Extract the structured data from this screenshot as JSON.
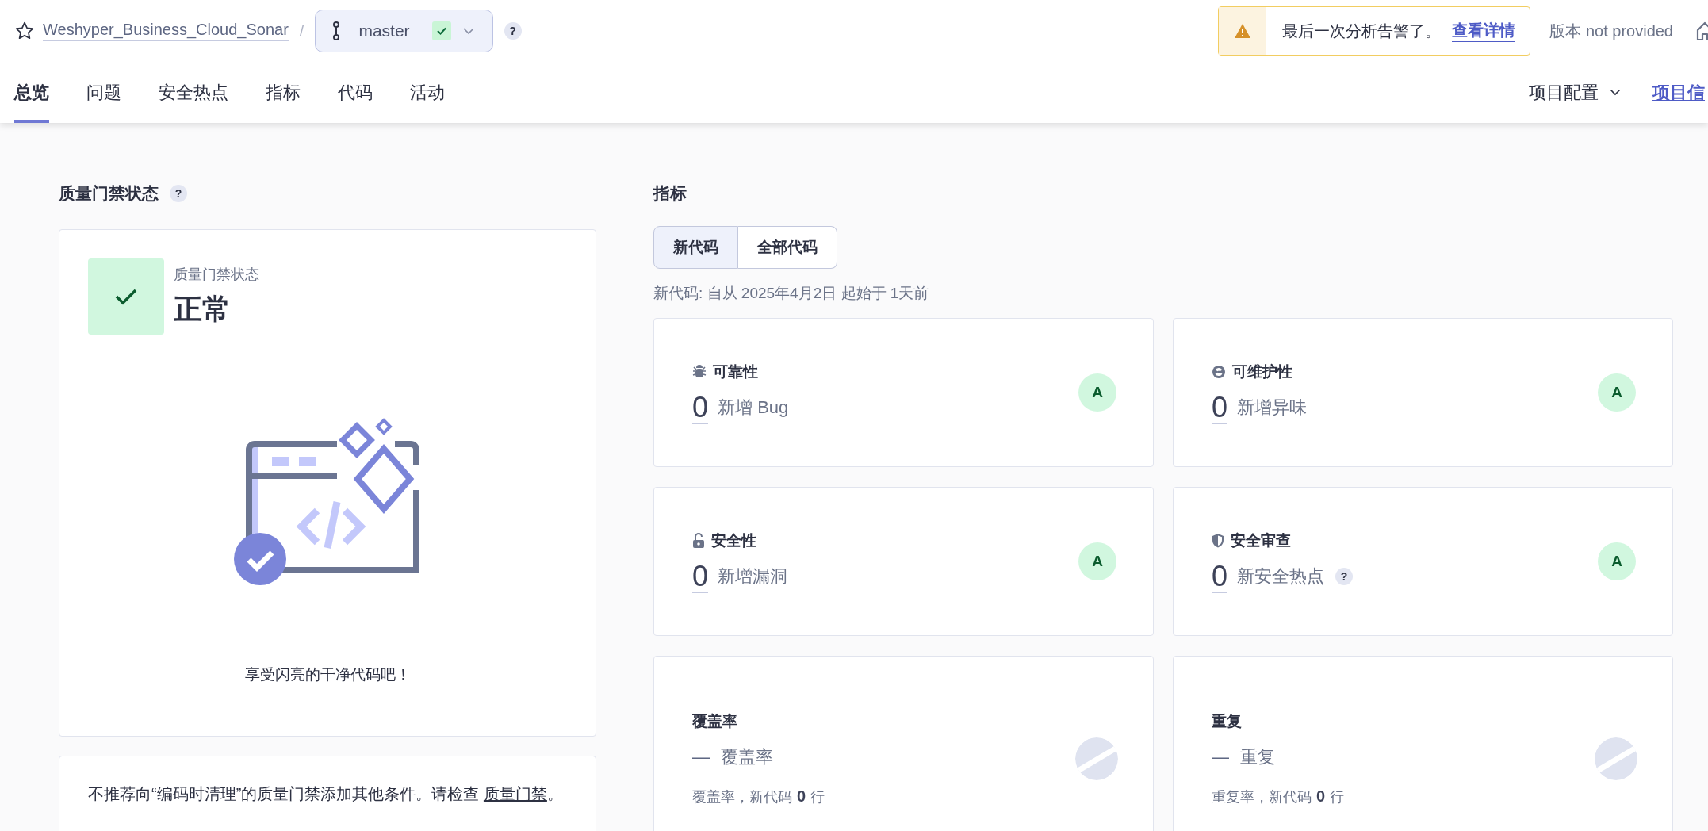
{
  "header": {
    "starred": false,
    "project": "Weshyper_Business_Cloud_Sonar",
    "separator": "/",
    "branch": "master",
    "branch_passed": true,
    "help": "?",
    "warning": {
      "message": "最后一次分析告警了。",
      "link": "查看详情"
    },
    "version": "版本 not provided",
    "tabs": [
      {
        "label": "总览",
        "selected": true
      },
      {
        "label": "问题",
        "selected": false
      },
      {
        "label": "安全热点",
        "selected": false
      },
      {
        "label": "指标",
        "selected": false
      },
      {
        "label": "代码",
        "selected": false
      },
      {
        "label": "活动",
        "selected": false
      }
    ],
    "right_nav": [
      {
        "label": "项目配置",
        "kind": "menu"
      },
      {
        "label": "项目信",
        "kind": "link"
      }
    ]
  },
  "quality_gate": {
    "title": "质量门禁状态",
    "help": "?",
    "status_caption": "质量门禁状态",
    "status": "正常",
    "passed": true,
    "message": "享受闪亮的干净代码吧！",
    "notice": {
      "text": "不推荐向“编码时清理”的质量门禁添加其他条件。请检查 ",
      "link": "质量门禁",
      "end": "。"
    }
  },
  "metrics": {
    "title": "指标",
    "toggle": [
      {
        "label": "新代码",
        "selected": true
      },
      {
        "label": "全部代码",
        "selected": false
      }
    ],
    "period": "新代码: 自从 2025年4月2日  起始于 1天前",
    "cards": [
      {
        "kind": "rating",
        "title": "可靠性",
        "value": "0",
        "label": "新增 Bug",
        "rating": "A"
      },
      {
        "kind": "rating",
        "title": "可维护性",
        "value": "0",
        "label": "新增异味",
        "rating": "A"
      },
      {
        "kind": "rating",
        "title": "安全性",
        "value": "0",
        "label": "新增漏洞",
        "rating": "A"
      },
      {
        "kind": "rating",
        "title": "安全审查",
        "value": "0",
        "label": "新安全热点",
        "help": "?",
        "rating": "A"
      },
      {
        "kind": "percent",
        "title": "覆盖率",
        "value": "—",
        "label": "覆盖率",
        "footer": "覆盖率，新代码",
        "footer_value": "0",
        "footer_unit": "行"
      },
      {
        "kind": "percent",
        "title": "重复",
        "value": "—",
        "label": "重复",
        "footer": "重复率，新代码",
        "footer_value": "0",
        "footer_unit": "行"
      }
    ]
  }
}
